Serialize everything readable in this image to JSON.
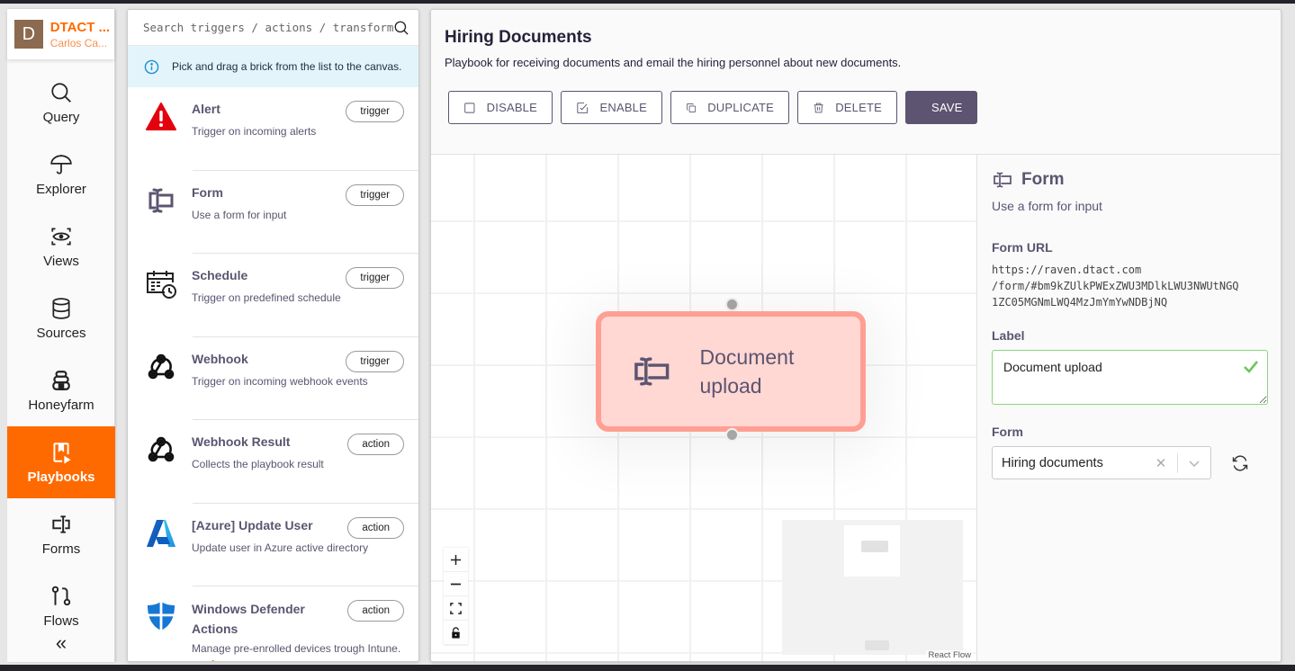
{
  "nav": {
    "org_initial": "D",
    "org_name": "DTACT ...",
    "user_name": "Carlos Ca...",
    "items": [
      {
        "label": "Query",
        "icon": "search-icon"
      },
      {
        "label": "Explorer",
        "icon": "umbrella-icon"
      },
      {
        "label": "Views",
        "icon": "eye-icon"
      },
      {
        "label": "Sources",
        "icon": "database-icon"
      },
      {
        "label": "Honeyfarm",
        "icon": "beehive-icon"
      },
      {
        "label": "Playbooks",
        "icon": "playbook-icon",
        "active": true
      },
      {
        "label": "Forms",
        "icon": "form-icon"
      },
      {
        "label": "Flows",
        "icon": "flow-icon"
      }
    ],
    "collapse_glyph": "«"
  },
  "bricks": {
    "search_placeholder": "Search triggers / actions / transforms",
    "info_text": "Pick and drag a brick from the list to the canvas.",
    "items": [
      {
        "title": "Alert",
        "description": "Trigger on incoming alerts",
        "tag": "trigger",
        "icon": "alert-icon"
      },
      {
        "title": "Form",
        "description": "Use a form for input",
        "tag": "trigger",
        "icon": "form-icon"
      },
      {
        "title": "Schedule",
        "description": "Trigger on predefined schedule",
        "tag": "trigger",
        "icon": "schedule-icon"
      },
      {
        "title": "Webhook",
        "description": "Trigger on incoming webhook events",
        "tag": "trigger",
        "icon": "webhook-icon"
      },
      {
        "title": "Webhook Result",
        "description": "Collects the playbook result",
        "tag": "action",
        "icon": "webhook-icon"
      },
      {
        "title": "[Azure] Update User",
        "description": "Update user in Azure active directory",
        "tag": "action",
        "icon": "azure-icon"
      },
      {
        "title": "Windows Defender Actions",
        "description": "Manage pre-enrolled devices trough Intune.",
        "tag": "action",
        "icon": "defender-shield-icon",
        "read_more": "read more"
      }
    ]
  },
  "playbook": {
    "title": "Hiring Documents",
    "description": "Playbook for receiving documents and email the hiring personnel about new documents.",
    "actions": {
      "disable": "DISABLE",
      "enable": "ENABLE",
      "duplicate": "DUPLICATE",
      "delete": "DELETE",
      "save": "SAVE"
    }
  },
  "canvas": {
    "node_label": "Document upload",
    "attribution": "React Flow",
    "controls": [
      "zoom-in",
      "zoom-out",
      "fit-view",
      "toggle-lock"
    ]
  },
  "side": {
    "title": "Form",
    "description": "Use a form for input",
    "form_url_label": "Form URL",
    "form_url": "https://raven.dtact.com\n/form/#bm9kZUlkPWExZWU3MDlkLWU3NWUtNGQ\n1ZC05MGNmLWQ4MzJmYmYwNDBjNQ",
    "label_label": "Label",
    "label_value": "Document upload",
    "form_label": "Form",
    "form_value": "Hiring documents",
    "clear_glyph": "✕"
  },
  "colors": {
    "accent": "#ff6a00",
    "primary": "#5c5470",
    "node_fill": "#ffd7d3",
    "node_border": "#ff9f94",
    "valid": "#8bd67c"
  }
}
